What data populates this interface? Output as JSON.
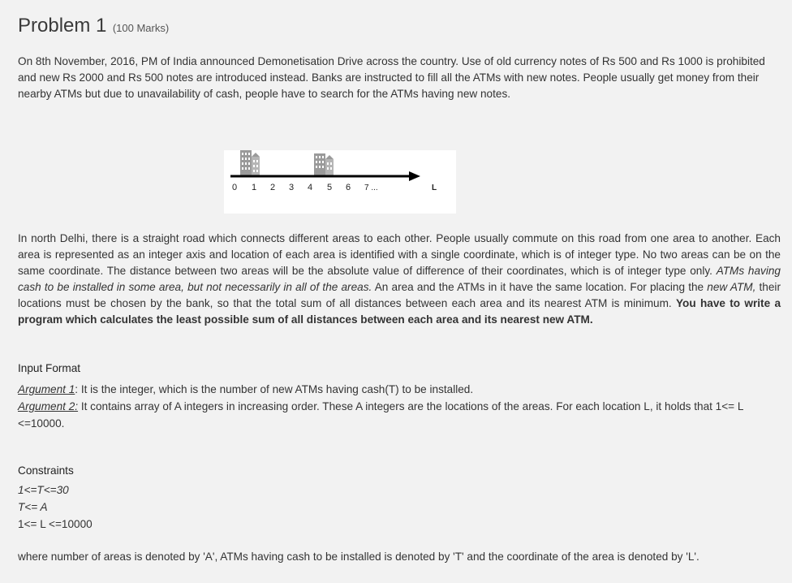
{
  "title": "Problem 1",
  "marks": "(100 Marks)",
  "intro": "On 8th November, 2016, PM of India announced Demonetisation Drive across the country. Use of old currency notes of Rs 500 and Rs 1000 is prohibited and new Rs 2000 and Rs 500 notes are introduced instead. Banks are instructed to fill all the ATMs with new notes. People usually get money from their nearby ATMs but due to unavailability of cash, people have to search for the ATMs having new notes.",
  "figure": {
    "ticks": [
      "0",
      "1",
      "2",
      "3",
      "4",
      "5",
      "6",
      "7 ..."
    ],
    "end_label": "L",
    "building_icon": "building-icon"
  },
  "body": {
    "part1": "In north Delhi, there is a straight road which connects different areas to each other. People usually commute on this road from one area to another. Each area is represented as an integer axis and location of each area is identified with a single coordinate, which is of integer type. No two areas can be on the same coordinate. The distance between two areas will be the absolute value of difference of their coordinates, which is of integer type only. ",
    "italic1": "ATMs having cash to be installed in some area, but not necessarily in all of the areas.",
    "part2": " An area and the ATMs in it have the same location. For placing the ",
    "italic2": "new ATM,",
    "part3": " their locations must be chosen by the bank, so that the total sum of all distances between each area and its nearest ATM is minimum. ",
    "bold": "You have to write a program which calculates the least possible sum of all distances between each area and its nearest new ATM."
  },
  "input_format": {
    "heading": "Input Format",
    "arg1_label": "Argument 1",
    "arg1_text": ": It is the integer, which is the number of new ATMs having cash(T) to be installed.",
    "arg2_label": "Argument 2:",
    "arg2_text": " It contains array of A integers in increasing order. These A integers are the locations of the areas. For each location L, it holds that 1<= L <=10000."
  },
  "constraints": {
    "heading": "Constraints",
    "items": [
      "1<=T<=30",
      "T<= A",
      "1<= L <=10000"
    ]
  },
  "footer": "where number of areas is denoted by 'A',  ATMs having cash to be installed is denoted by 'T' and the coordinate of the area is denoted by 'L'."
}
